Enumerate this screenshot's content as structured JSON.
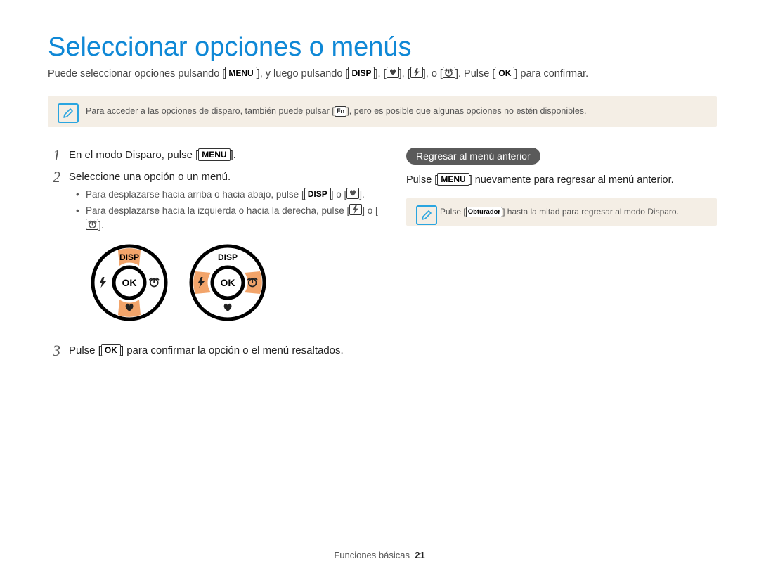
{
  "title": "Seleccionar opciones o menús",
  "intro": {
    "a": "Puede seleccionar opciones pulsando [",
    "menu": "MENU",
    "b": "], y luego pulsando [",
    "disp": "DISP",
    "c": "], [",
    "d": "], [",
    "e": "], o [",
    "f": "]. Pulse [",
    "ok": "OK",
    "g": "] para confirmar."
  },
  "tip1": {
    "a": "Para acceder a las opciones de disparo, también puede pulsar [",
    "fn": "Fn",
    "b": "], pero es posible que algunas opciones no estén disponibles."
  },
  "steps": {
    "s1": {
      "num": "1",
      "a": "En el modo Disparo, pulse [",
      "menu": "MENU",
      "b": "]."
    },
    "s2": {
      "num": "2",
      "text": "Seleccione una opción o un menú.",
      "sub1": {
        "a": "Para desplazarse hacia arriba o hacia abajo, pulse [",
        "disp": "DISP",
        "b": "] o [",
        "c": "]."
      },
      "sub2": {
        "a": "Para desplazarse hacia la izquierda o hacia la derecha, pulse [",
        "b": "] o [",
        "c": "]."
      }
    },
    "s3": {
      "num": "3",
      "a": "Pulse [",
      "ok": "OK",
      "b": "] para confirmar la opción o el menú resaltados."
    }
  },
  "right": {
    "heading": "Regresar al menú anterior",
    "text": {
      "a": "Pulse [",
      "menu": "MENU",
      "b": "] nuevamente para regresar al menú anterior."
    },
    "tip": {
      "a": "Pulse [",
      "btn": "Obturador",
      "b": "] hasta la mitad para regresar al modo Disparo."
    }
  },
  "dialLabels": {
    "disp": "DISP",
    "ok": "OK"
  },
  "footer": {
    "section": "Funciones básicas",
    "page": "21"
  }
}
